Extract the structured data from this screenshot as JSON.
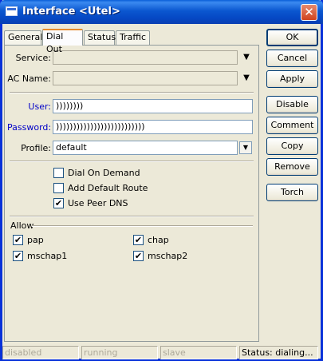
{
  "window": {
    "title": "Interface <Utel>",
    "close_glyph": "✕"
  },
  "tabs": [
    {
      "label": "General"
    },
    {
      "label": "Dial Out",
      "active": true
    },
    {
      "label": "Status"
    },
    {
      "label": "Traffic"
    }
  ],
  "form": {
    "service": {
      "label": "Service:",
      "value": ""
    },
    "ac_name": {
      "label": "AC Name:",
      "value": ""
    },
    "user": {
      "label": "User:",
      "value": "))))))))"
    },
    "password": {
      "label": "Password:",
      "value": "))))))))))))))))))))))))))"
    },
    "profile": {
      "label": "Profile:",
      "value": "default"
    }
  },
  "options": {
    "dial_on_demand": {
      "label": "Dial On Demand",
      "checked": false
    },
    "add_default_route": {
      "label": "Add Default Route",
      "checked": false
    },
    "use_peer_dns": {
      "label": "Use Peer DNS",
      "checked": true
    }
  },
  "allow": {
    "title": "Allow",
    "pap": {
      "label": "pap",
      "checked": true
    },
    "chap": {
      "label": "chap",
      "checked": true
    },
    "mschap1": {
      "label": "mschap1",
      "checked": true
    },
    "mschap2": {
      "label": "mschap2",
      "checked": true
    }
  },
  "buttons": {
    "ok": "OK",
    "cancel": "Cancel",
    "apply": "Apply",
    "disable": "Disable",
    "comment": "Comment",
    "copy": "Copy",
    "remove": "Remove",
    "torch": "Torch"
  },
  "status": {
    "disabled": "disabled",
    "running": "running",
    "slave": "slave",
    "state": "Status: dialing..."
  },
  "icons": {
    "dropdown": "▼",
    "check": "✔"
  },
  "colors": {
    "title_bar": "#0b57d0",
    "label_blue": "#0000c8",
    "panel_bg": "#ece9d8"
  }
}
